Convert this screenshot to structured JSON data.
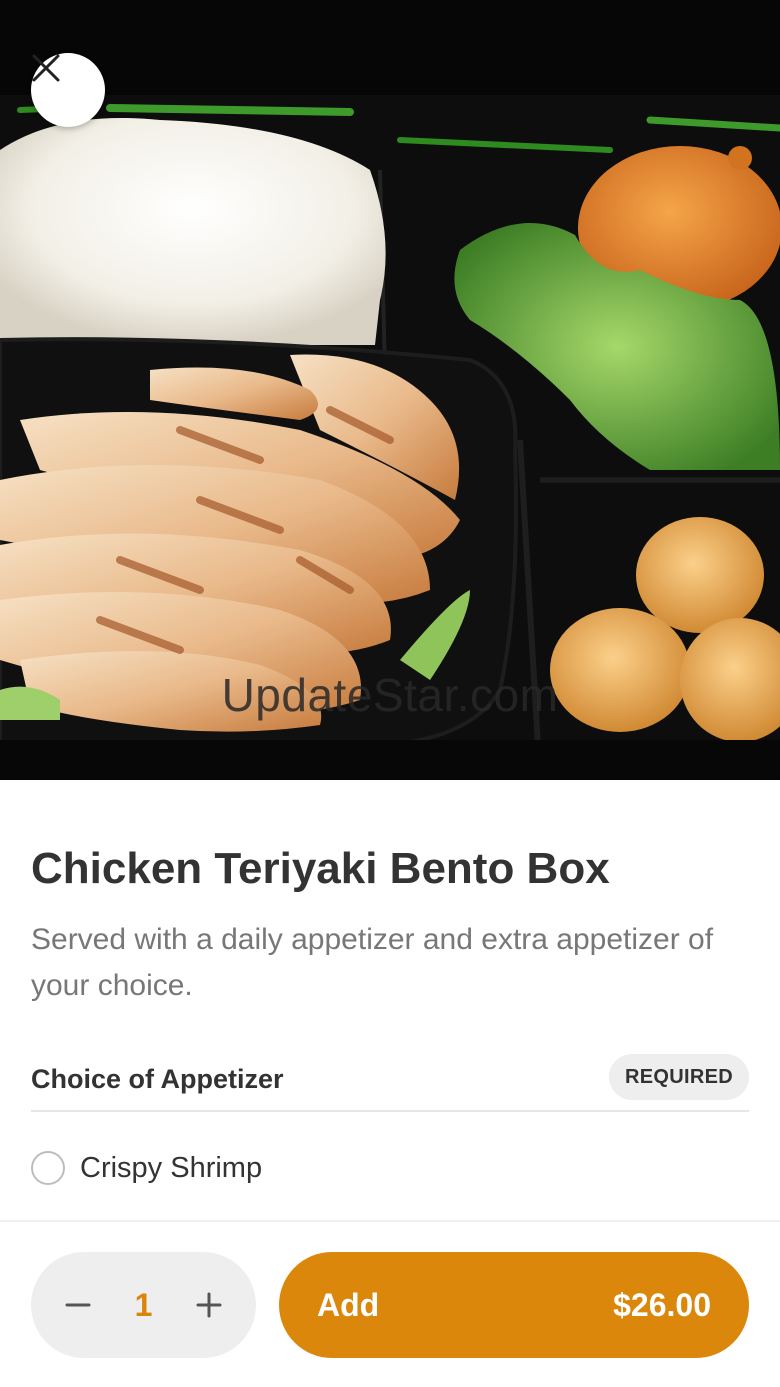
{
  "hero": {
    "watermark": "UpdateStar.com"
  },
  "item": {
    "title": "Chicken Teriyaki Bento Box",
    "description": "Served with a daily appetizer and extra appetizer of your choice."
  },
  "appetizer_section": {
    "title": "Choice of Appetizer",
    "badge": "REQUIRED",
    "options": [
      {
        "label": "Crispy Shrimp",
        "selected": false
      }
    ]
  },
  "footer": {
    "quantity": "1",
    "add_label": "Add",
    "price": "$26.00"
  },
  "colors": {
    "accent": "#db870b",
    "quantity_text": "#d9850b",
    "badge_bg": "#eeeeee"
  },
  "icons": {
    "close": "close-icon",
    "minus": "minus-icon",
    "plus": "plus-icon"
  }
}
